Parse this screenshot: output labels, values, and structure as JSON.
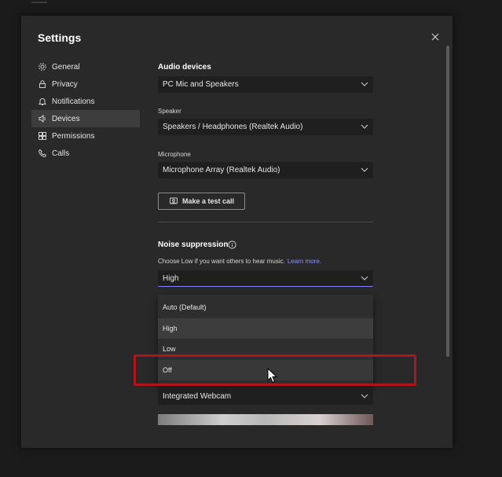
{
  "dialog": {
    "title": "Settings"
  },
  "nav": {
    "items": [
      {
        "label": "General",
        "icon": "gear-icon"
      },
      {
        "label": "Privacy",
        "icon": "lock-icon"
      },
      {
        "label": "Notifications",
        "icon": "bell-icon"
      },
      {
        "label": "Devices",
        "icon": "speaker-icon",
        "active": true
      },
      {
        "label": "Permissions",
        "icon": "grid-icon"
      },
      {
        "label": "Calls",
        "icon": "phone-icon"
      }
    ]
  },
  "audio": {
    "title": "Audio devices",
    "device_value": "PC Mic and Speakers",
    "speaker_label": "Speaker",
    "speaker_value": "Speakers / Headphones (Realtek Audio)",
    "mic_label": "Microphone",
    "mic_value": "Microphone Array (Realtek Audio)",
    "test_call_label": "Make a test call"
  },
  "noise": {
    "title": "Noise suppression",
    "helper": "Choose Low if you want others to hear music.",
    "learn_more": "Learn more.",
    "selected": "High",
    "options": [
      "Auto (Default)",
      "High",
      "Low",
      "Off"
    ]
  },
  "camera": {
    "value": "Integrated Webcam"
  },
  "colors": {
    "accent": "#7f85f5",
    "link": "#8e92f3",
    "annotation": "#b0141c",
    "background": "#292929"
  }
}
